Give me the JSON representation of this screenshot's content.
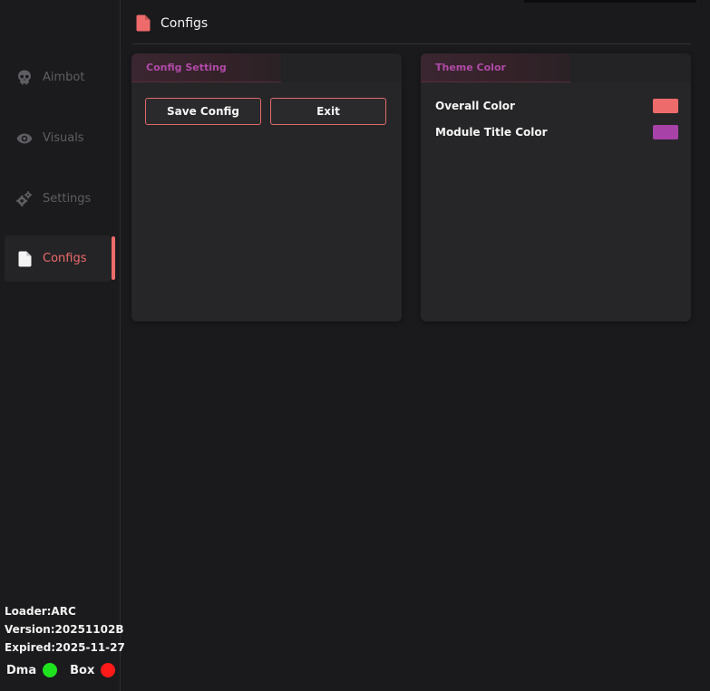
{
  "header": {
    "title": "Configs",
    "icon": "file-icon",
    "icon_color": "#ee6b6b"
  },
  "sidebar": {
    "items": [
      {
        "label": "Aimbot",
        "icon": "skull-icon",
        "active": false
      },
      {
        "label": "Visuals",
        "icon": "eye-icon",
        "active": false
      },
      {
        "label": "Settings",
        "icon": "gear-icon",
        "active": false
      },
      {
        "label": "Configs",
        "icon": "file-icon",
        "active": true
      }
    ],
    "active_color": "#ee6b6b",
    "inactive_color": "#5e5e62"
  },
  "info": {
    "loader": "Loader:ARC",
    "version": "Version:20251102B",
    "expired": "Expired:2025-11-27"
  },
  "status": {
    "dma_label": "Dma",
    "dma_color": "#1fe21f",
    "box_label": "Box",
    "box_color": "#ff1a1a"
  },
  "config_panel": {
    "title": "Config Setting",
    "title_color": "#b04aa8",
    "save_label": "Save Config",
    "exit_label": "Exit"
  },
  "theme_panel": {
    "title": "Theme Color",
    "title_color": "#b04aa8",
    "rows": [
      {
        "label": "Overall Color",
        "color": "#ee6b6b"
      },
      {
        "label": "Module Title Color",
        "color": "#a742a8"
      }
    ]
  }
}
